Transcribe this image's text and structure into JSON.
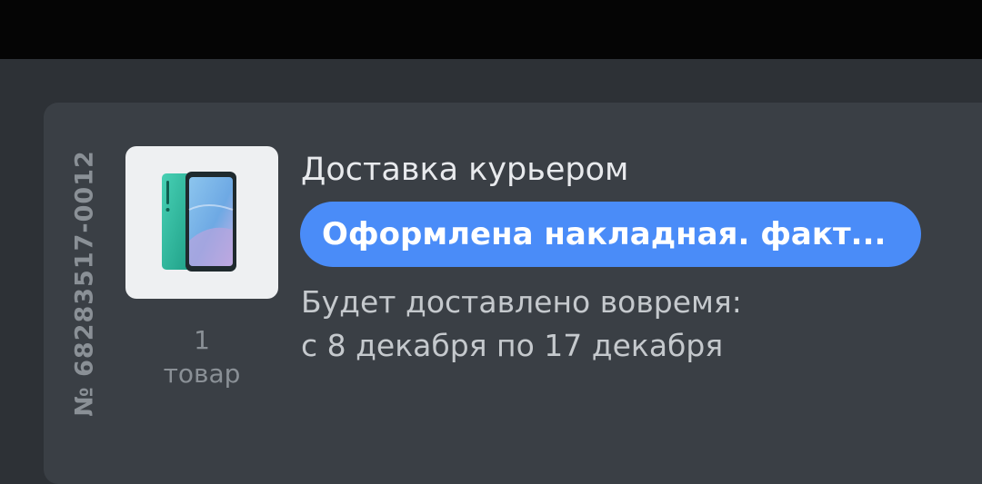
{
  "order": {
    "number": "№ 68283517-0012",
    "item_count": "1",
    "item_unit": "товар",
    "product_icon": "smartphone-image",
    "delivery_method": "Доставка курьером",
    "status": "Оформлена накладная. факт...",
    "delivery_line1": "Будет доставлено вовремя:",
    "delivery_line2": "с 8 декабря по 17 декабря"
  },
  "colors": {
    "status_bar": "#050505",
    "background": "#2d3136",
    "card": "#3a3f45",
    "status_badge": "#4a8cf8"
  }
}
